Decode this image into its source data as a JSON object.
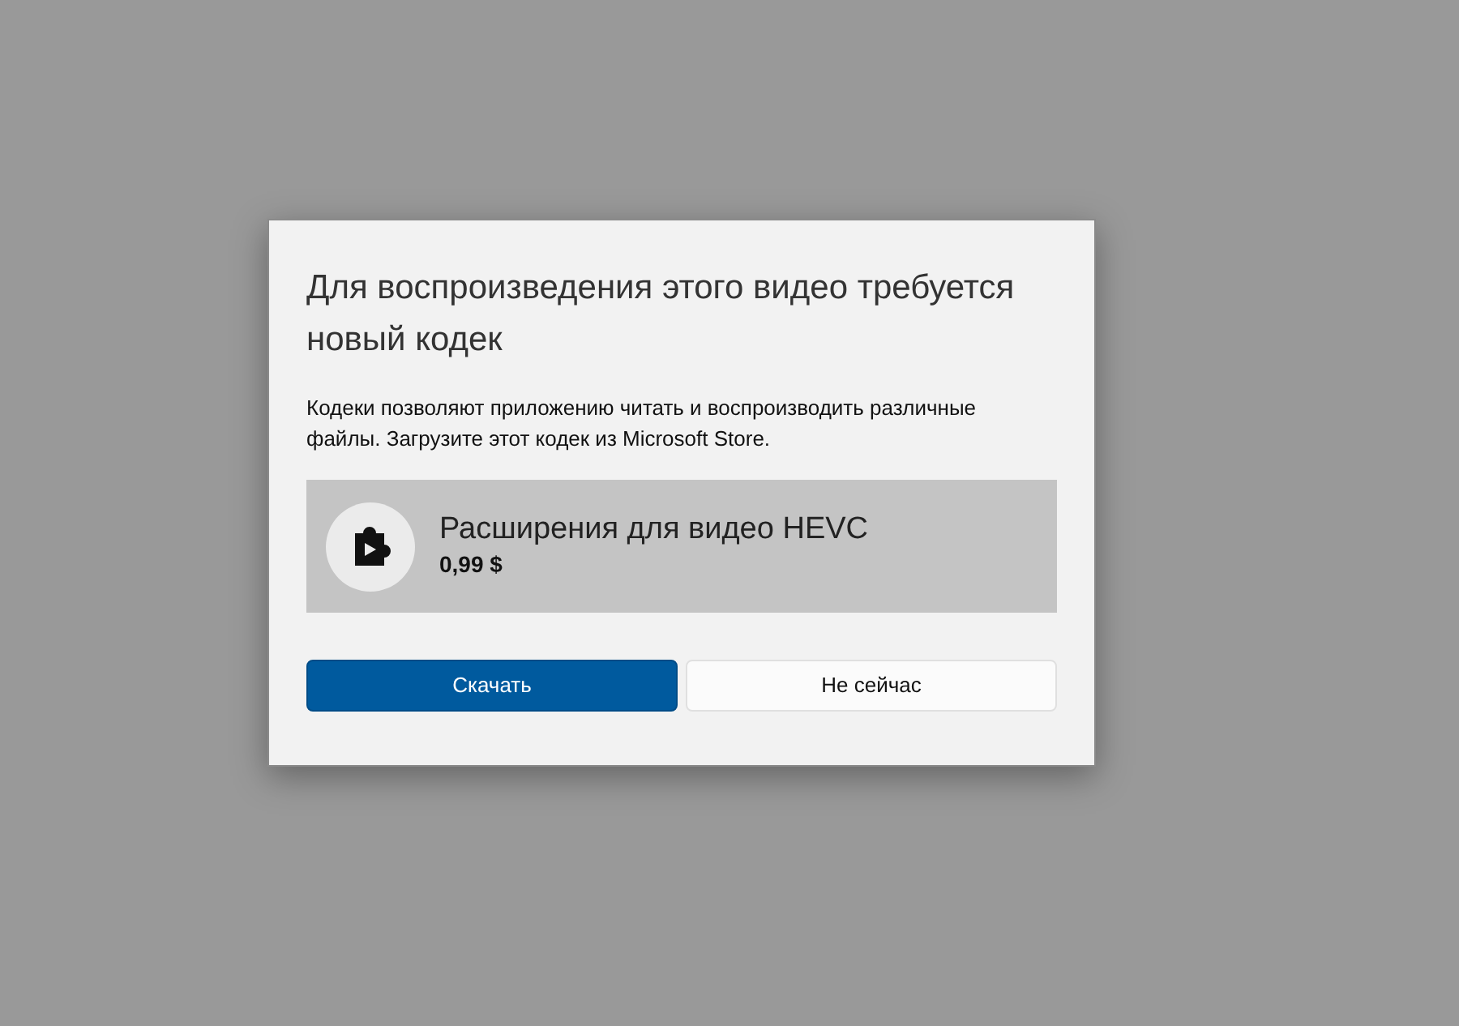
{
  "dialog": {
    "title": "Для воспроизведения этого видео требуется новый кодек",
    "message": "Кодеки позволяют приложению читать и воспроизводить различные файлы. Загрузите этот кодек из Microsoft Store.",
    "product": {
      "name": "Расширения для видео HEVC",
      "price": "0,99 $"
    },
    "buttons": [
      {
        "label": "Скачать",
        "kind": "primary"
      },
      {
        "label": "Не сейчас",
        "kind": "secondary"
      }
    ]
  }
}
